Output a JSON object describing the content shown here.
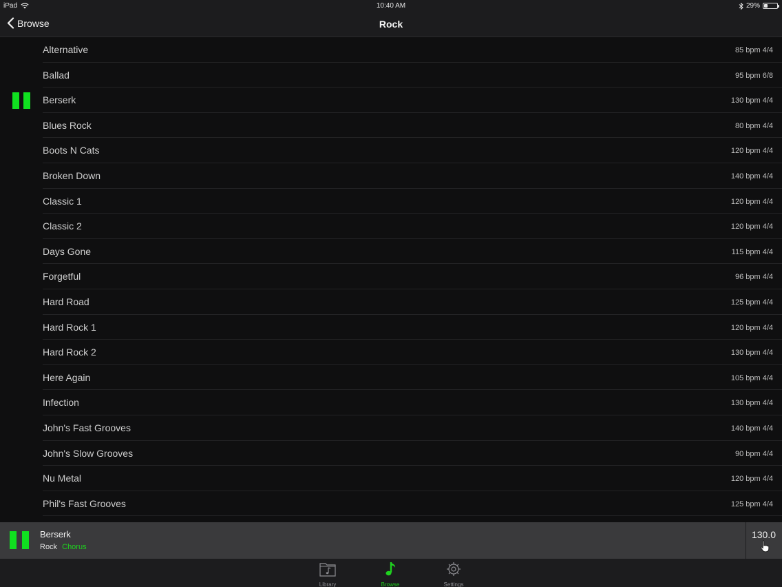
{
  "status_bar": {
    "device": "iPad",
    "time": "10:40 AM",
    "battery": "29%",
    "battery_level": 0.29
  },
  "nav": {
    "back_label": "Browse",
    "title": "Rock"
  },
  "colors": {
    "accent": "#10e020",
    "background": "#0f0f10",
    "bar": "#1c1c1e",
    "now_playing_bg": "#3a3a3c"
  },
  "grooves": [
    {
      "title": "Alternative",
      "meta": "85 bpm 4/4"
    },
    {
      "title": "Ballad",
      "meta": "95 bpm 6/8"
    },
    {
      "title": "Berserk",
      "meta": "130 bpm 4/4",
      "playing": true
    },
    {
      "title": "Blues Rock",
      "meta": "80 bpm 4/4"
    },
    {
      "title": "Boots N Cats",
      "meta": "120 bpm 4/4"
    },
    {
      "title": "Broken Down",
      "meta": "140 bpm 4/4"
    },
    {
      "title": "Classic 1",
      "meta": "120 bpm 4/4"
    },
    {
      "title": "Classic 2",
      "meta": "120 bpm 4/4"
    },
    {
      "title": "Days Gone",
      "meta": "115 bpm 4/4"
    },
    {
      "title": "Forgetful",
      "meta": "96 bpm 4/4"
    },
    {
      "title": "Hard Road",
      "meta": "125 bpm 4/4"
    },
    {
      "title": "Hard Rock 1",
      "meta": "120 bpm 4/4"
    },
    {
      "title": "Hard Rock 2",
      "meta": "130 bpm 4/4"
    },
    {
      "title": "Here Again",
      "meta": "105 bpm 4/4"
    },
    {
      "title": "Infection",
      "meta": "130 bpm 4/4"
    },
    {
      "title": "John's Fast Grooves",
      "meta": "140 bpm 4/4"
    },
    {
      "title": "John's Slow Grooves",
      "meta": "90 bpm 4/4"
    },
    {
      "title": "Nu Metal",
      "meta": "120 bpm 4/4"
    },
    {
      "title": "Phil's Fast Grooves",
      "meta": "125 bpm 4/4"
    }
  ],
  "now_playing": {
    "title": "Berserk",
    "genre": "Rock",
    "part": "Chorus",
    "tempo": "130.0"
  },
  "tabs": [
    {
      "label": "Library",
      "icon": "library-folder-icon",
      "active": false
    },
    {
      "label": "Browse",
      "icon": "music-note-icon",
      "active": true
    },
    {
      "label": "Settings",
      "icon": "gear-icon",
      "active": false
    }
  ]
}
